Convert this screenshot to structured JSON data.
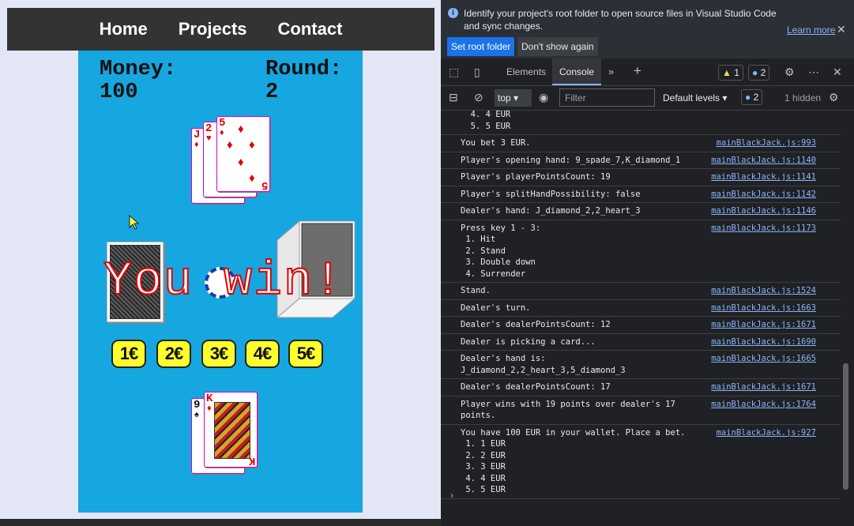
{
  "nav": {
    "home": "Home",
    "projects": "Projects",
    "contact": "Contact"
  },
  "game": {
    "money_label": "Money:",
    "money_value": "100",
    "round_label": "Round:",
    "round_value": "2",
    "result_text": "You win!",
    "chips": [
      "1€",
      "2€",
      "3€",
      "4€",
      "5€"
    ],
    "dealer_cards": [
      {
        "rank": "J",
        "suit": "♦"
      },
      {
        "rank": "2",
        "suit": "♥"
      },
      {
        "rank": "5",
        "suit": "♦"
      }
    ],
    "player_cards": [
      {
        "rank": "9",
        "suit": "♠"
      },
      {
        "rank": "K",
        "suit": "♦"
      }
    ],
    "colors": {
      "table": "#16a6e0",
      "chip": "#ffff2e",
      "card_border": "#d400d4",
      "result": "#e00000"
    }
  },
  "devtools": {
    "banner": {
      "message": "Identify your project's root folder to open source files in Visual Studio Code and sync changes.",
      "learn_more": "Learn more",
      "set_root": "Set root folder",
      "dont_show": "Don't show again"
    },
    "tabs": {
      "elements": "Elements",
      "console": "Console"
    },
    "warnings": "1",
    "issues": "2",
    "toolbar": {
      "context": "top",
      "filter_placeholder": "Filter",
      "levels": "Default levels",
      "issues": "2",
      "hidden": "1 hidden"
    },
    "logs": [
      {
        "text": "  4. 4 EUR\n  5. 5 EUR",
        "src": ""
      },
      {
        "text": "You bet 3 EUR.",
        "src": "mainBlackJack.js:993"
      },
      {
        "text": "Player's opening hand: 9_spade_7,K_diamond_1",
        "src": "mainBlackJack.js:1140"
      },
      {
        "text": "Player's playerPointsCount: 19",
        "src": "mainBlackJack.js:1141"
      },
      {
        "text": "Player's splitHandPossibility: false",
        "src": "mainBlackJack.js:1142"
      },
      {
        "text": "Dealer's hand: J_diamond_2,2_heart_3",
        "src": "mainBlackJack.js:1146"
      },
      {
        "text": "Press key 1 - 3:\n 1. Hit\n 2. Stand\n 3. Double down\n 4. Surrender",
        "src": "mainBlackJack.js:1173"
      },
      {
        "text": "Stand.",
        "src": "mainBlackJack.js:1524"
      },
      {
        "text": "Dealer's turn.",
        "src": "mainBlackJack.js:1663"
      },
      {
        "text": "Dealer's dealerPointsCount: 12",
        "src": "mainBlackJack.js:1671"
      },
      {
        "text": "Dealer is picking a card...",
        "src": "mainBlackJack.js:1690"
      },
      {
        "text": "Dealer's hand is:\nJ_diamond_2,2_heart_3,5_diamond_3",
        "src": "mainBlackJack.js:1665"
      },
      {
        "text": "Dealer's dealerPointsCount: 17",
        "src": "mainBlackJack.js:1671"
      },
      {
        "text": "Player wins with 19 points over dealer's 17\npoints.",
        "src": "mainBlackJack.js:1764"
      },
      {
        "text": "You have 100 EUR in your wallet. Place a bet.\n 1. 1 EUR\n 2. 2 EUR\n 3. 3 EUR\n 4. 4 EUR\n 5. 5 EUR",
        "src": "mainBlackJack.js:927"
      }
    ],
    "prompt": "›"
  }
}
